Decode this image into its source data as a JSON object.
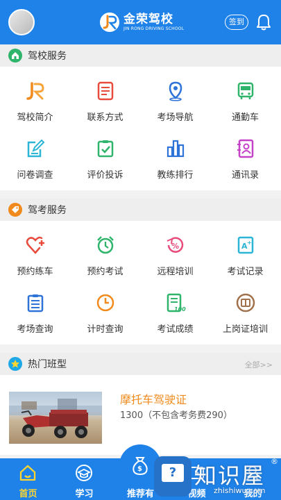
{
  "header": {
    "brand_title": "金荣驾校",
    "brand_subtitle": "JIN RONG DRIVING SCHOOL",
    "checkin_label": "签到"
  },
  "sections": {
    "school_service": {
      "title": "驾校服务",
      "items": [
        {
          "label": "驾校简介",
          "icon": "school-logo-icon"
        },
        {
          "label": "联系方式",
          "icon": "contact-card-icon"
        },
        {
          "label": "考场导航",
          "icon": "location-pin-icon"
        },
        {
          "label": "通勤车",
          "icon": "bus-icon"
        },
        {
          "label": "问卷调查",
          "icon": "survey-edit-icon"
        },
        {
          "label": "评价投诉",
          "icon": "review-check-icon"
        },
        {
          "label": "教练排行",
          "icon": "ranking-bars-icon"
        },
        {
          "label": "通讯录",
          "icon": "address-book-icon"
        }
      ]
    },
    "exam_service": {
      "title": "驾考服务",
      "items": [
        {
          "label": "预约练车",
          "icon": "heart-plus-icon"
        },
        {
          "label": "预约考试",
          "icon": "alarm-clock-icon"
        },
        {
          "label": "远程培训",
          "icon": "percent-circle-icon"
        },
        {
          "label": "考试记录",
          "icon": "grade-doc-icon"
        },
        {
          "label": "考场查询",
          "icon": "clipboard-list-icon"
        },
        {
          "label": "计时查询",
          "icon": "clock-icon"
        },
        {
          "label": "考试成绩",
          "icon": "score-sheet-icon"
        },
        {
          "label": "上岗证培训",
          "icon": "certificate-book-icon"
        }
      ]
    },
    "hot_classes": {
      "title": "热门班型",
      "more_label": "全部>>",
      "items": [
        {
          "title": "摩托车驾驶证",
          "price": "1300（不包含考务费290）"
        }
      ]
    }
  },
  "tabbar": {
    "tabs": [
      {
        "label": "首页",
        "active": true
      },
      {
        "label": "学习",
        "active": false
      },
      {
        "label": "推荐有",
        "active": false
      },
      {
        "label": "视频",
        "active": false
      },
      {
        "label": "我的",
        "active": false
      }
    ]
  },
  "watermark": {
    "text": "知识屋",
    "url": "zhishiwu.com",
    "reg": "®"
  },
  "colors": {
    "primary": "#1e82e8",
    "accent_orange": "#f08a1c",
    "active_tab": "#ffd531"
  }
}
